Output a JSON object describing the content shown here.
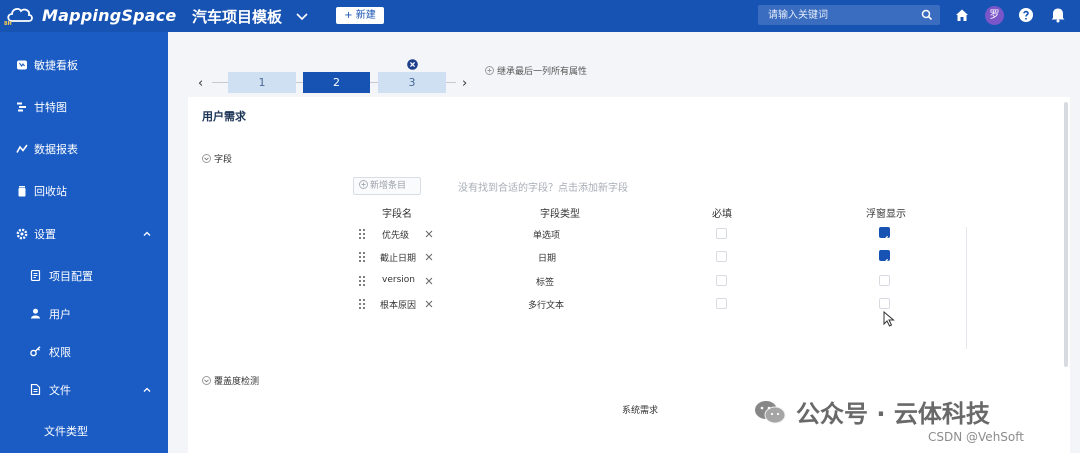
{
  "header": {
    "logo_text": "MappingSpace",
    "logo_sub": "8H",
    "project_title": "汽车项目模板",
    "new_button": "+ 新建",
    "search_placeholder": "请输入关键词",
    "avatar": "罗",
    "brand_color": "#1753b3"
  },
  "sidebar": {
    "items": [
      {
        "label": "敏捷看板",
        "icon": "kanban-icon"
      },
      {
        "label": "甘特图",
        "icon": "gantt-icon"
      },
      {
        "label": "数据报表",
        "icon": "chart-icon"
      },
      {
        "label": "回收站",
        "icon": "trash-icon"
      },
      {
        "label": "设置",
        "icon": "gear-icon",
        "expanded": true
      }
    ],
    "settings_children": [
      {
        "label": "项目配置",
        "icon": "doc-icon"
      },
      {
        "label": "用户",
        "icon": "user-icon"
      },
      {
        "label": "权限",
        "icon": "key-icon"
      },
      {
        "label": "文件",
        "icon": "file-icon",
        "expanded": true
      }
    ],
    "file_children": [
      {
        "label": "文件类型"
      }
    ]
  },
  "stepper": {
    "steps": [
      "1",
      "2",
      "3"
    ],
    "active": "2",
    "inherit_label": "继承最后一列所有属性"
  },
  "card": {
    "title": "用户需求",
    "fields_section": "字段",
    "add_entry_label": "新增条目",
    "hint": "没有找到合适的字段？点击添加新字段",
    "headers": {
      "name": "字段名",
      "type": "字段类型",
      "required": "必填",
      "popup": "浮窗显示"
    },
    "rows": [
      {
        "name": "优先级",
        "type": "单选项",
        "required": false,
        "popup": true
      },
      {
        "name": "截止日期",
        "type": "日期",
        "required": false,
        "popup": true
      },
      {
        "name": "version",
        "type": "标签",
        "required": false,
        "popup": false
      },
      {
        "name": "根本原因",
        "type": "多行文本",
        "required": false,
        "popup": false
      }
    ],
    "coverage_section": "覆盖度检测",
    "coverage_item": "系统需求"
  },
  "watermark": {
    "text": "公众号 · 云体科技",
    "csdn": "CSDN @VehSoft"
  }
}
